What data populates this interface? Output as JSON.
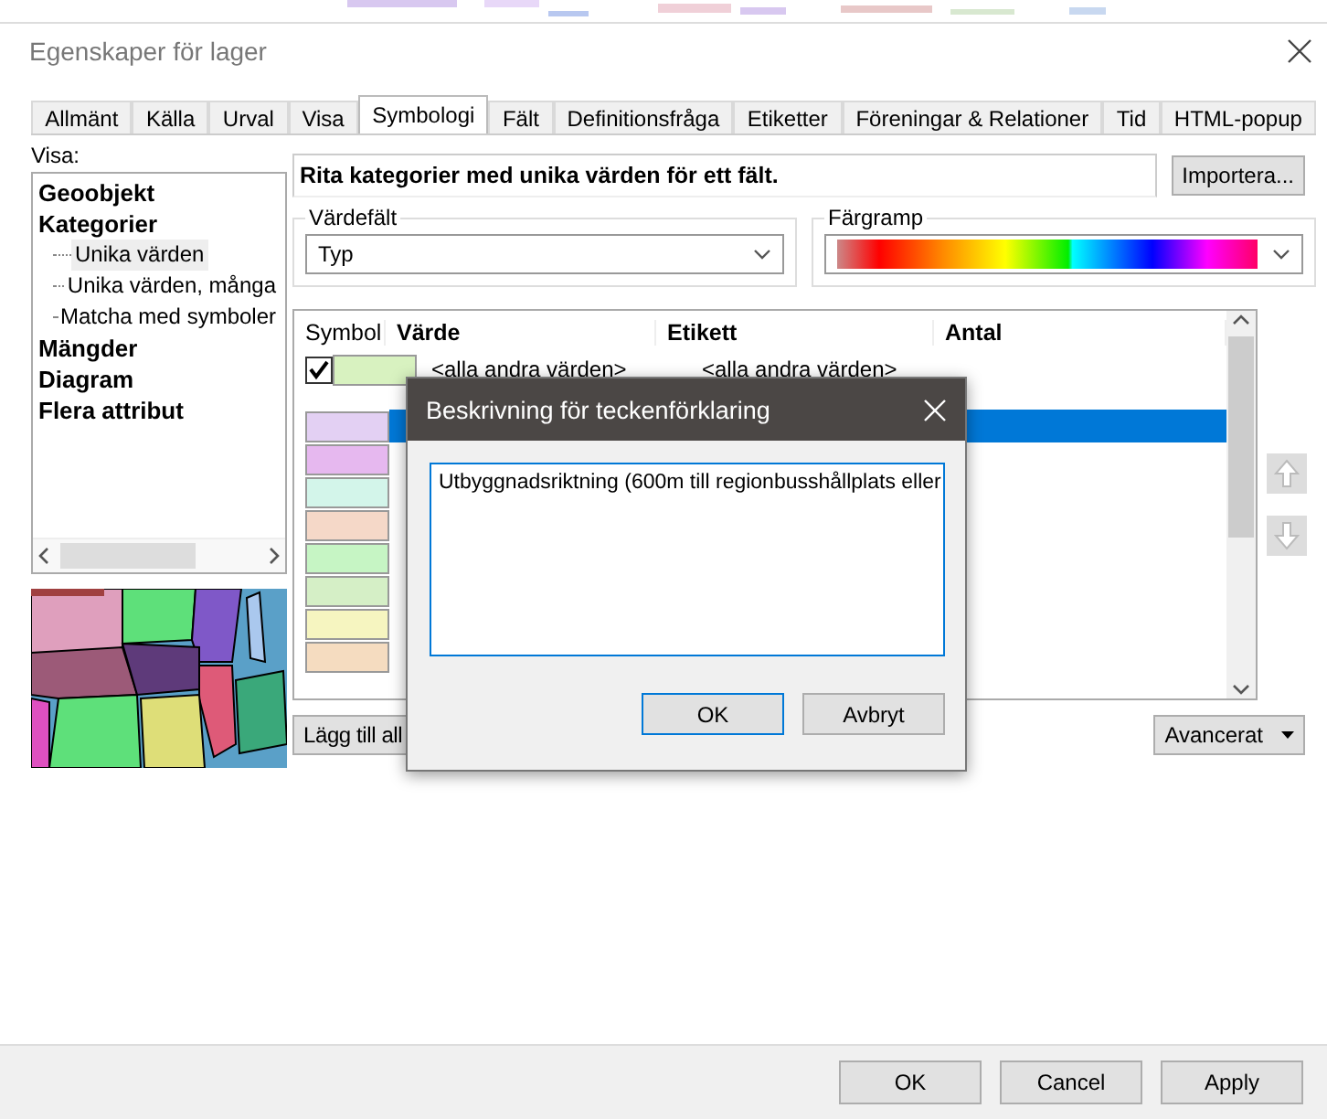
{
  "window": {
    "title": "Egenskaper för lager"
  },
  "tabs": [
    {
      "label": "Allmänt",
      "selected": false
    },
    {
      "label": "Källa",
      "selected": false
    },
    {
      "label": "Urval",
      "selected": false
    },
    {
      "label": "Visa",
      "selected": false
    },
    {
      "label": "Symbologi",
      "selected": true
    },
    {
      "label": "Fält",
      "selected": false
    },
    {
      "label": "Definitionsfråga",
      "selected": false
    },
    {
      "label": "Etiketter",
      "selected": false
    },
    {
      "label": "Föreningar & Relationer",
      "selected": false
    },
    {
      "label": "Tid",
      "selected": false
    },
    {
      "label": "HTML-popup",
      "selected": false
    }
  ],
  "show": {
    "label": "Visa:",
    "tree": [
      {
        "label": "Geoobjekt"
      },
      {
        "label": "Kategorier",
        "children": [
          {
            "label": "Unika värden",
            "selected": true
          },
          {
            "label": "Unika värden, många",
            "selected": false
          },
          {
            "label": "Matcha med symboler",
            "selected": false
          }
        ]
      },
      {
        "label": "Mängder"
      },
      {
        "label": "Diagram"
      },
      {
        "label": "Flera attribut"
      }
    ]
  },
  "description": "Rita kategorier med unika värden för ett fält.",
  "import_button": "Importera...",
  "value_field": {
    "label": "Värdefält",
    "value": "Typ"
  },
  "color_ramp": {
    "label": "Färgramp"
  },
  "table": {
    "columns": [
      "Symbol",
      "Värde",
      "Etikett",
      "Antal"
    ],
    "all_other": {
      "checked": true,
      "color": "#d8f2c0",
      "value": "<alla andra värden>",
      "label": "<alla andra värden>"
    },
    "rows": [
      {
        "color": "#e3d0f3",
        "selected": true
      },
      {
        "color": "#e6b8ef",
        "selected": false
      },
      {
        "color": "#d3f5ea",
        "selected": false
      },
      {
        "color": "#f5d8c8",
        "selected": false
      },
      {
        "color": "#c6f5c4",
        "selected": false
      },
      {
        "color": "#d5efc6",
        "selected": false
      },
      {
        "color": "#f6f5c0",
        "selected": false
      },
      {
        "color": "#f5dcc0",
        "selected": false
      }
    ]
  },
  "add_all_button": "Lägg till all",
  "advanced_button": "Avancerat",
  "modal": {
    "title": "Beskrivning för teckenförklaring",
    "value": "Utbyggnadsriktning (600m till regionbusshållplats eller",
    "ok": "OK",
    "cancel": "Avbryt"
  },
  "footer": [
    "OK",
    "Cancel",
    "Apply"
  ]
}
